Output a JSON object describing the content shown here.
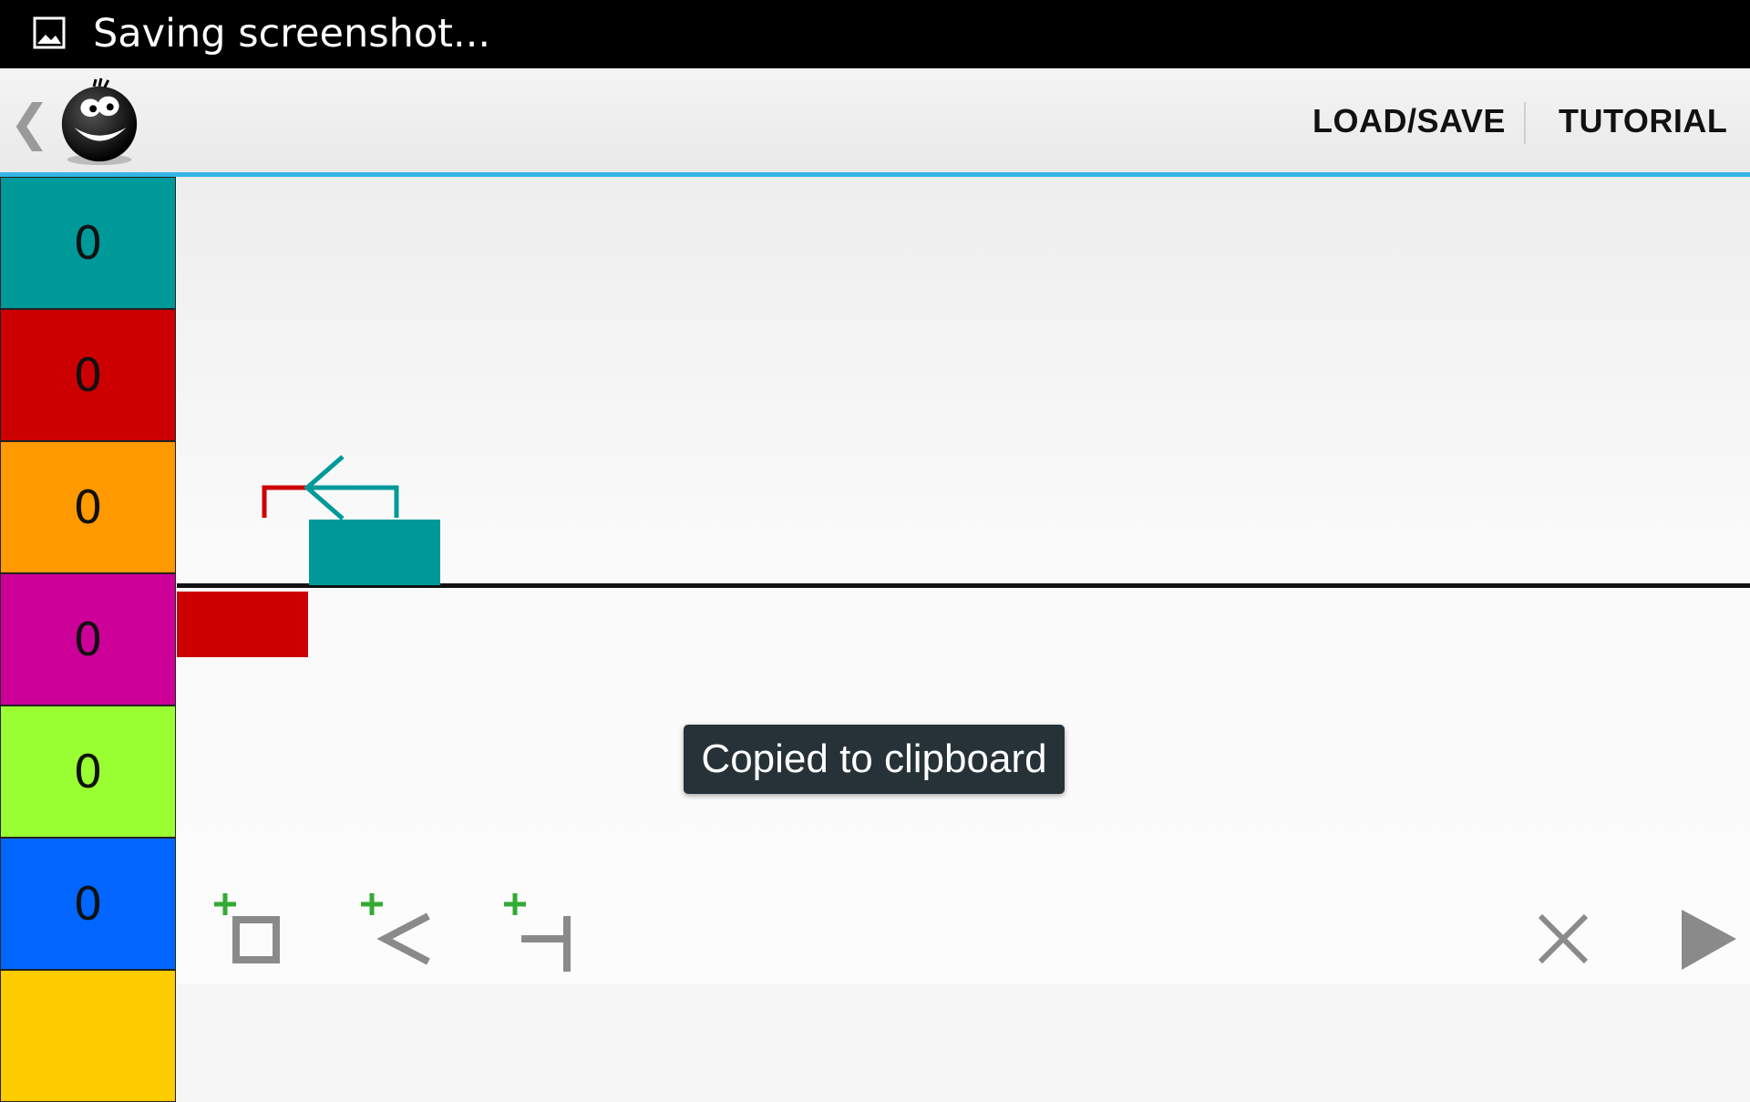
{
  "status_bar": {
    "icon": "image-icon",
    "text": "Saving screenshot..."
  },
  "action_bar": {
    "back_icon": "chevron-left-icon",
    "logo_icon": "smiley-face-logo",
    "buttons": {
      "load_save": "LOAD/SAVE",
      "tutorial": "TUTORIAL"
    },
    "accent_color": "#33b5e5"
  },
  "counters": [
    {
      "color": "#009999",
      "value": "0"
    },
    {
      "color": "#cc0000",
      "value": "0"
    },
    {
      "color": "#ff9900",
      "value": "0"
    },
    {
      "color": "#cc0099",
      "value": "0"
    },
    {
      "color": "#99ff33",
      "value": "0"
    },
    {
      "color": "#0066ff",
      "value": "0"
    },
    {
      "color": "#ffcc00",
      "value": ""
    }
  ],
  "scene": {
    "blocks": [
      {
        "name": "teal-block",
        "color": "#009999"
      },
      {
        "name": "red-block",
        "color": "#cc0000"
      }
    ],
    "gadgets": [
      {
        "name": "red-bracket",
        "color": "#cc0000"
      },
      {
        "name": "teal-arrow",
        "color": "#009999"
      }
    ]
  },
  "toast": {
    "text": "Copied to clipboard"
  },
  "toolbar": {
    "tools": [
      "add-block-icon",
      "add-arrow-icon",
      "add-bracket-icon"
    ],
    "delete_icon": "close-icon",
    "play_icon": "play-icon",
    "add_color": "#33aa33",
    "tool_color": "#8a8a8a"
  }
}
